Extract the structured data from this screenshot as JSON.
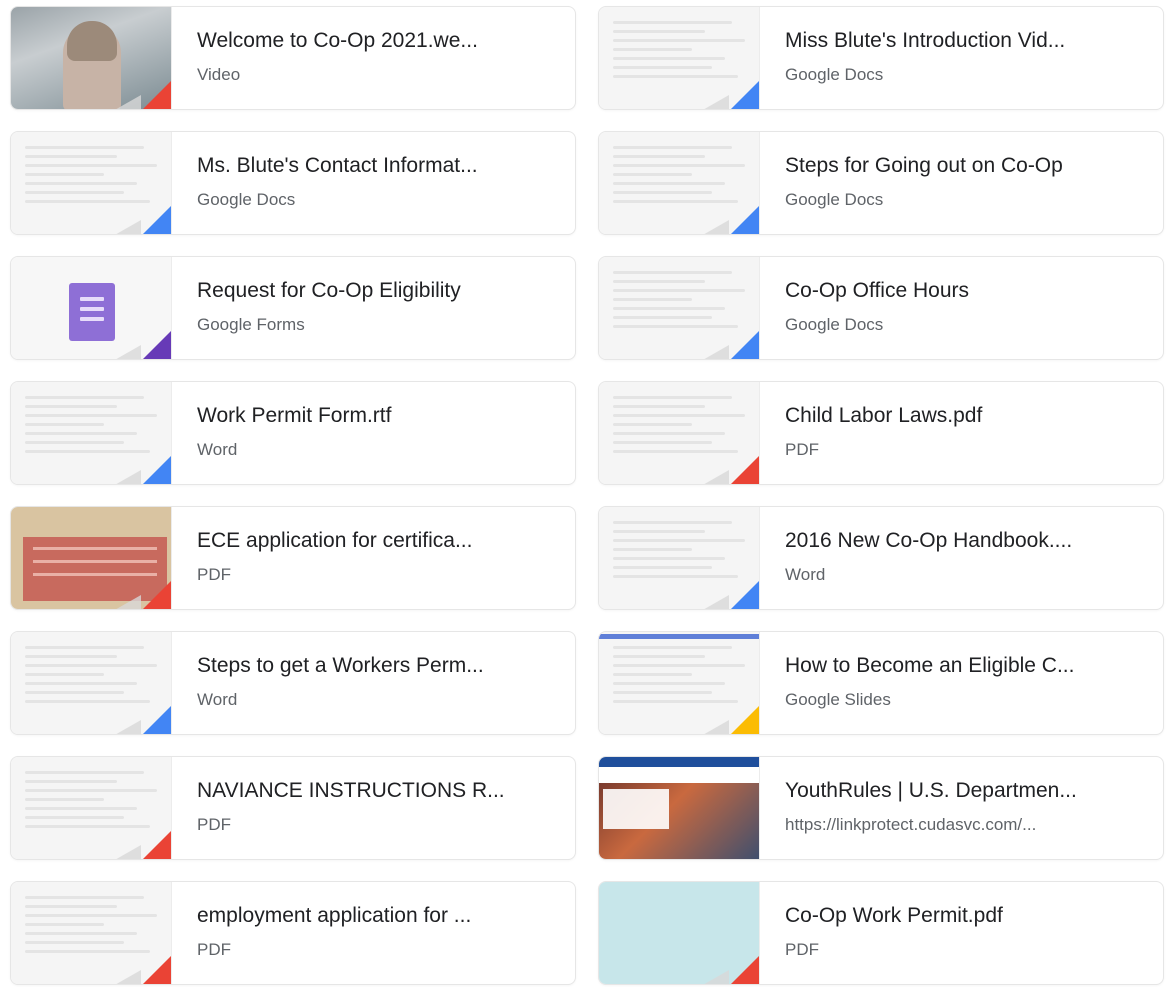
{
  "items": [
    {
      "title": "Welcome to Co-Op 2021.we...",
      "type": "Video",
      "thumb": "video",
      "corner_color": "#ea4335"
    },
    {
      "title": "Miss Blute's Introduction Vid...",
      "type": "Google Docs",
      "thumb": "doc",
      "corner_color": "#4285f4"
    },
    {
      "title": "Ms. Blute's Contact Informat...",
      "type": "Google Docs",
      "thumb": "doc",
      "corner_color": "#4285f4"
    },
    {
      "title": "Steps for Going out on Co-Op",
      "type": "Google Docs",
      "thumb": "doc",
      "corner_color": "#4285f4"
    },
    {
      "title": "Request for Co-Op Eligibility",
      "type": "Google Forms",
      "thumb": "form",
      "corner_color": "#673ab7"
    },
    {
      "title": "Co-Op Office Hours",
      "type": "Google Docs",
      "thumb": "doc",
      "corner_color": "#4285f4"
    },
    {
      "title": "Work Permit Form.rtf",
      "type": "Word",
      "thumb": "doc",
      "corner_color": "#4285f4"
    },
    {
      "title": "Child Labor Laws.pdf",
      "type": "PDF",
      "thumb": "doc",
      "corner_color": "#ea4335"
    },
    {
      "title": "ECE application for certifica...",
      "type": "PDF",
      "thumb": "ece",
      "corner_color": "#ea4335"
    },
    {
      "title": "2016 New Co-Op Handbook....",
      "type": "Word",
      "thumb": "doc",
      "corner_color": "#4285f4"
    },
    {
      "title": "Steps to get a Workers Perm...",
      "type": "Word",
      "thumb": "doc",
      "corner_color": "#4285f4"
    },
    {
      "title": "How to Become an Eligible C...",
      "type": "Google Slides",
      "thumb": "slides",
      "corner_color": "#fbbc04"
    },
    {
      "title": "NAVIANCE INSTRUCTIONS R...",
      "type": "PDF",
      "thumb": "doc",
      "corner_color": "#ea4335"
    },
    {
      "title": "YouthRules | U.S. Departmen...",
      "type": "https://linkprotect.cudasvc.com/...",
      "thumb": "web",
      "corner_color": ""
    },
    {
      "title": "employment application for ...",
      "type": "PDF",
      "thumb": "doc",
      "corner_color": "#ea4335"
    },
    {
      "title": "Co-Op Work Permit.pdf",
      "type": "PDF",
      "thumb": "cyan",
      "corner_color": "#ea4335"
    }
  ]
}
